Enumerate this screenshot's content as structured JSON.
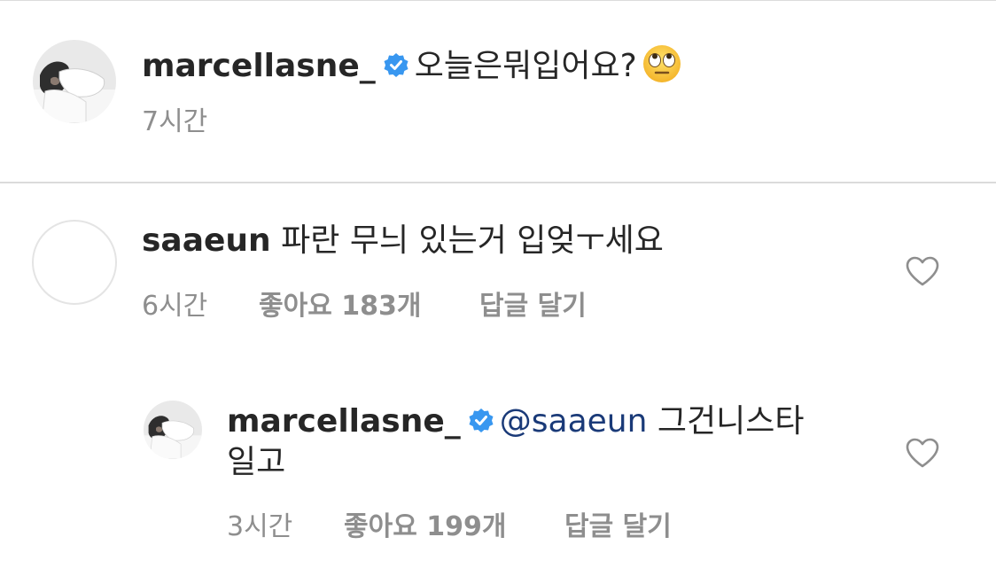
{
  "post_caption": {
    "username": "marcellasne_",
    "verified": true,
    "text": "오늘은뭐입어요?",
    "emoji": "face-with-rolling-eyes",
    "time": "7시간"
  },
  "comments": [
    {
      "username": "saaeun",
      "verified": false,
      "text": "파란 무늬 있는거 입엊ㅜ세요",
      "time": "6시간",
      "likes": "좋아요 183개",
      "reply_label": "답글 달기",
      "heart_icon": "heart-outline-icon"
    },
    {
      "username": "marcellasne_",
      "verified": true,
      "mention": "@saaeun",
      "text_line1": "그건니스타",
      "text_line2": "일고",
      "time": "3시간",
      "likes": "좋아요 199개",
      "reply_label": "답글 달기",
      "heart_icon": "heart-outline-icon"
    }
  ],
  "colors": {
    "verified_badge": "#3897f0",
    "mention": "#1a3a78",
    "meta_text": "#8e8e8e",
    "divider": "#dbdbdb"
  }
}
